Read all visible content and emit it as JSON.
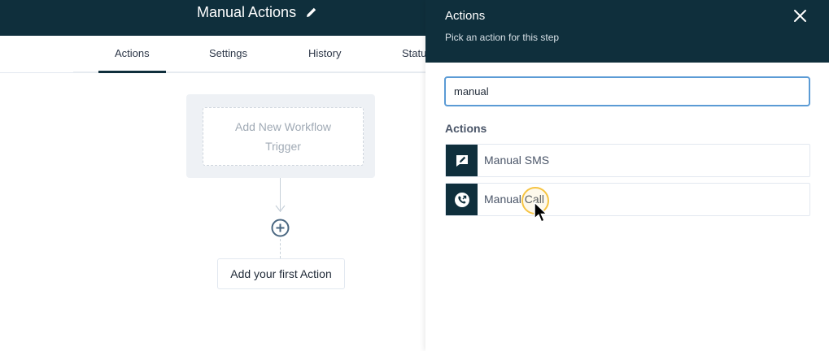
{
  "workflow": {
    "title": "Manual Actions",
    "edit_icon": "pencil-icon"
  },
  "tabs": [
    {
      "label": "Actions",
      "active": true
    },
    {
      "label": "Settings",
      "active": false
    },
    {
      "label": "History",
      "active": false
    },
    {
      "label": "Statu",
      "active": false
    }
  ],
  "canvas": {
    "trigger_text": "Add New Workflow Trigger",
    "plus_icon": "plus-circle-icon",
    "first_action_label": "Add your first Action"
  },
  "panel": {
    "title": "Actions",
    "subtitle": "Pick an action for this step",
    "close_icon": "close-icon",
    "search_value": "manual",
    "section_label": "Actions",
    "items": [
      {
        "label": "Manual SMS",
        "icon": "sms-edit-icon"
      },
      {
        "label": "Manual Call",
        "icon": "phone-call-icon"
      }
    ]
  },
  "colors": {
    "header_bg": "#0f2f3c",
    "input_focus": "#5b9bd5",
    "cursor_highlight": "#f6c443"
  }
}
